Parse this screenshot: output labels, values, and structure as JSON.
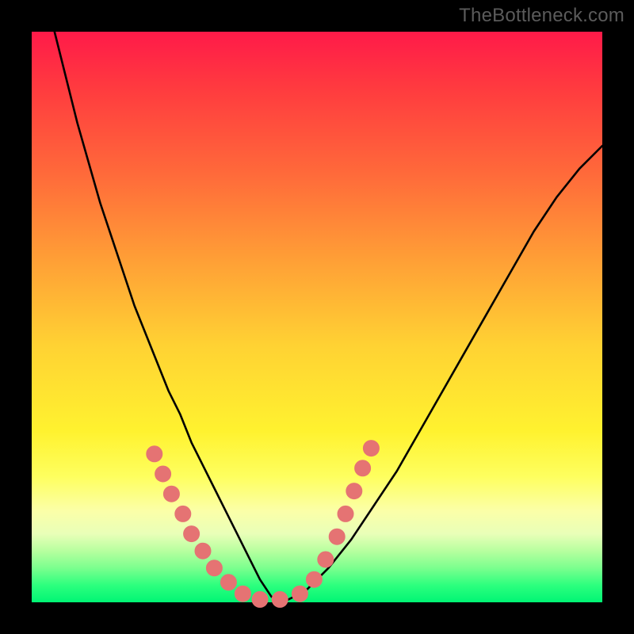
{
  "watermark": "TheBottleneck.com",
  "colors": {
    "dot": "#e57373",
    "curve": "#000000",
    "frame": "#000000"
  },
  "chart_data": {
    "type": "line",
    "title": "",
    "xlabel": "",
    "ylabel": "",
    "xlim": [
      0,
      100
    ],
    "ylim": [
      0,
      100
    ],
    "grid": false,
    "legend": false,
    "series": [
      {
        "name": "bottleneck-curve",
        "x": [
          4,
          6,
          8,
          10,
          12,
          14,
          16,
          18,
          20,
          22,
          24,
          26,
          28,
          30,
          32,
          34,
          36,
          38,
          40,
          42,
          44,
          48,
          52,
          56,
          60,
          64,
          68,
          72,
          76,
          80,
          84,
          88,
          92,
          96,
          100
        ],
        "y": [
          100,
          92,
          84,
          77,
          70,
          64,
          58,
          52,
          47,
          42,
          37,
          33,
          28,
          24,
          20,
          16,
          12,
          8,
          4,
          1,
          0,
          2,
          6,
          11,
          17,
          23,
          30,
          37,
          44,
          51,
          58,
          65,
          71,
          76,
          80
        ]
      }
    ],
    "points": {
      "name": "sample-dots",
      "x_y": [
        [
          21.5,
          26.0
        ],
        [
          23.0,
          22.5
        ],
        [
          24.5,
          19.0
        ],
        [
          26.5,
          15.5
        ],
        [
          28.0,
          12.0
        ],
        [
          30.0,
          9.0
        ],
        [
          32.0,
          6.0
        ],
        [
          34.5,
          3.5
        ],
        [
          37.0,
          1.5
        ],
        [
          40.0,
          0.5
        ],
        [
          43.5,
          0.5
        ],
        [
          47.0,
          1.5
        ],
        [
          49.5,
          4.0
        ],
        [
          51.5,
          7.5
        ],
        [
          53.5,
          11.5
        ],
        [
          55.0,
          15.5
        ],
        [
          56.5,
          19.5
        ],
        [
          58.0,
          23.5
        ],
        [
          59.5,
          27.0
        ]
      ]
    }
  }
}
